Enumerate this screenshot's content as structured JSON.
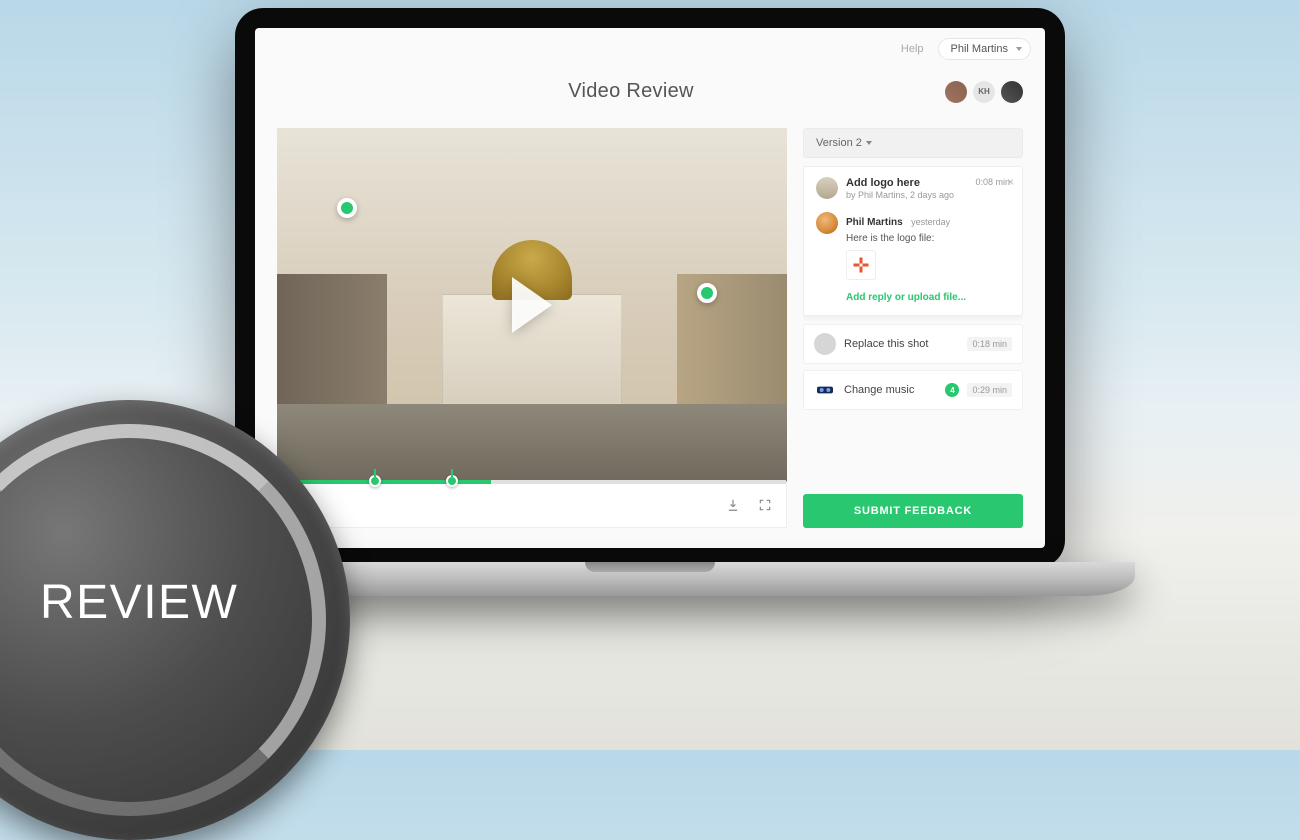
{
  "header": {
    "help_label": "Help",
    "user_name": "Phil Martins"
  },
  "page_title": "Video Review",
  "collaborators": [
    {
      "initials": ""
    },
    {
      "initials": "KH"
    },
    {
      "initials": ""
    }
  ],
  "video": {
    "annotations": [
      {
        "id": "a1"
      },
      {
        "id": "a2"
      }
    ],
    "timeline_markers": [
      {
        "pos_pct": 18
      },
      {
        "pos_pct": 33
      }
    ],
    "progress_pct": 42
  },
  "sidebar": {
    "version_label": "Version 2",
    "active_comment": {
      "title": "Add logo here",
      "meta": "by Phil Martins, 2 days ago",
      "timestamp": "0:08 min",
      "reply": {
        "author": "Phil Martins",
        "age": "yesterday",
        "text": "Here is the logo file:"
      },
      "add_reply_label": "Add reply or upload file..."
    },
    "comments": [
      {
        "title": "Replace this shot",
        "timestamp": "0:18 min",
        "badge": null
      },
      {
        "title": "Change music",
        "timestamp": "0:29 min",
        "badge": "4"
      }
    ],
    "submit_label": "SUBMIT FEEDBACK"
  },
  "overlay": {
    "badge_text": "REVIEW"
  },
  "colors": {
    "accent": "#29c76f"
  }
}
